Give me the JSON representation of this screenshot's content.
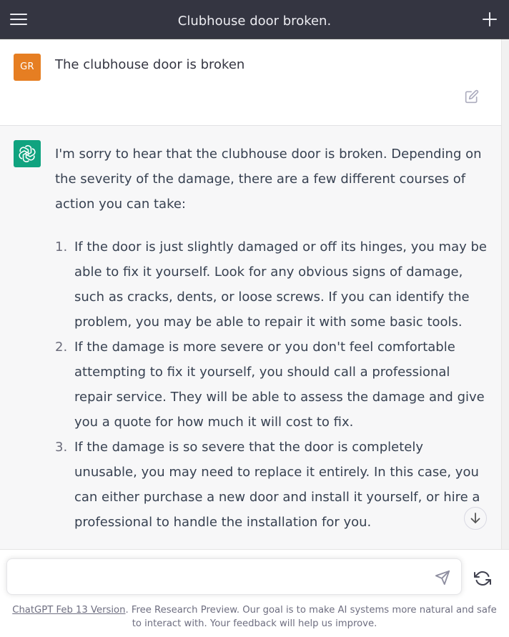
{
  "header": {
    "title": "Clubhouse door broken.",
    "menu_icon": "hamburger-menu-icon",
    "new_chat_icon": "plus-icon"
  },
  "user_message": {
    "avatar_initials": "GR",
    "avatar_color": "#e67e22",
    "text": "The clubhouse door is broken",
    "edit_icon": "edit-pencil-icon"
  },
  "assistant_message": {
    "avatar_icon": "openai-logo-icon",
    "avatar_color": "#10a37f",
    "intro": "I'm sorry to hear that the clubhouse door is broken. Depending on the severity of the damage, there are a few different courses of action you can take:",
    "items": [
      {
        "number": "1.",
        "text": "If the door is just slightly damaged or off its hinges, you may be able to fix it yourself. Look for any obvious signs of damage, such as cracks, dents, or loose screws. If you can identify the problem, you may be able to repair it with some basic tools."
      },
      {
        "number": "2.",
        "text": "If the damage is more severe or you don't feel comfortable attempting to fix it yourself, you should call a professional repair service. They will be able to assess the damage and give you a quote for how much it will cost to fix."
      },
      {
        "number": "3.",
        "text": "If the damage is so severe that the door is completely unusable, you may need to replace it entirely. In this case, you can either purchase a new door and install it yourself, or hire a professional to handle the installation for you."
      }
    ]
  },
  "composer": {
    "input_value": "",
    "send_icon": "paper-plane-send-icon",
    "regenerate_icon": "refresh-arrows-icon",
    "scroll_down_icon": "arrow-down-icon"
  },
  "footer": {
    "version_link": "ChatGPT Feb 13 Version",
    "text": ". Free Research Preview. Our goal is to make AI systems more natural and safe to interact with. Your feedback will help us improve."
  },
  "colors": {
    "header_bg": "#343541",
    "assistant_bg": "#f7f7f8",
    "text": "#374151"
  }
}
